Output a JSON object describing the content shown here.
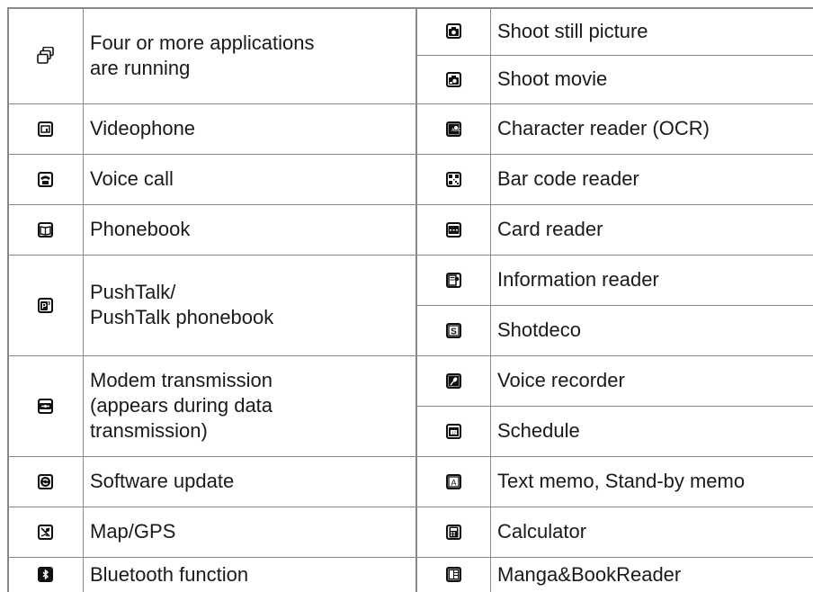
{
  "left": [
    {
      "icon": "stacked-apps-icon",
      "label": "Four or more applications\nare running"
    },
    {
      "icon": "videophone-icon",
      "label": "Videophone"
    },
    {
      "icon": "voice-call-icon",
      "label": "Voice call"
    },
    {
      "icon": "phonebook-icon",
      "label": "Phonebook"
    },
    {
      "icon": "pushtalk-icon",
      "label": "PushTalk/\nPushTalk phonebook"
    },
    {
      "icon": "modem-icon",
      "label": "Modem transmission\n(appears during data\ntransmission)"
    },
    {
      "icon": "software-update-icon",
      "label": "Software update"
    },
    {
      "icon": "map-gps-icon",
      "label": "Map/GPS"
    },
    {
      "icon": "bluetooth-icon",
      "label": "Bluetooth function"
    }
  ],
  "right": [
    {
      "icon": "camera-still-icon",
      "label": "Shoot still picture"
    },
    {
      "icon": "camera-movie-icon",
      "label": "Shoot movie"
    },
    {
      "icon": "ocr-camera-icon",
      "label": "Character reader (OCR)"
    },
    {
      "icon": "barcode-icon",
      "label": "Bar code reader"
    },
    {
      "icon": "card-reader-icon",
      "label": "Card reader"
    },
    {
      "icon": "info-reader-icon",
      "label": "Information reader"
    },
    {
      "icon": "shotdeco-icon",
      "label": "Shotdeco"
    },
    {
      "icon": "voice-recorder-icon",
      "label": "Voice recorder"
    },
    {
      "icon": "schedule-icon",
      "label": "Schedule"
    },
    {
      "icon": "text-memo-icon",
      "label": "Text memo, Stand-by memo"
    },
    {
      "icon": "calculator-icon",
      "label": "Calculator"
    },
    {
      "icon": "manga-reader-icon",
      "label": "Manga&BookReader"
    }
  ]
}
